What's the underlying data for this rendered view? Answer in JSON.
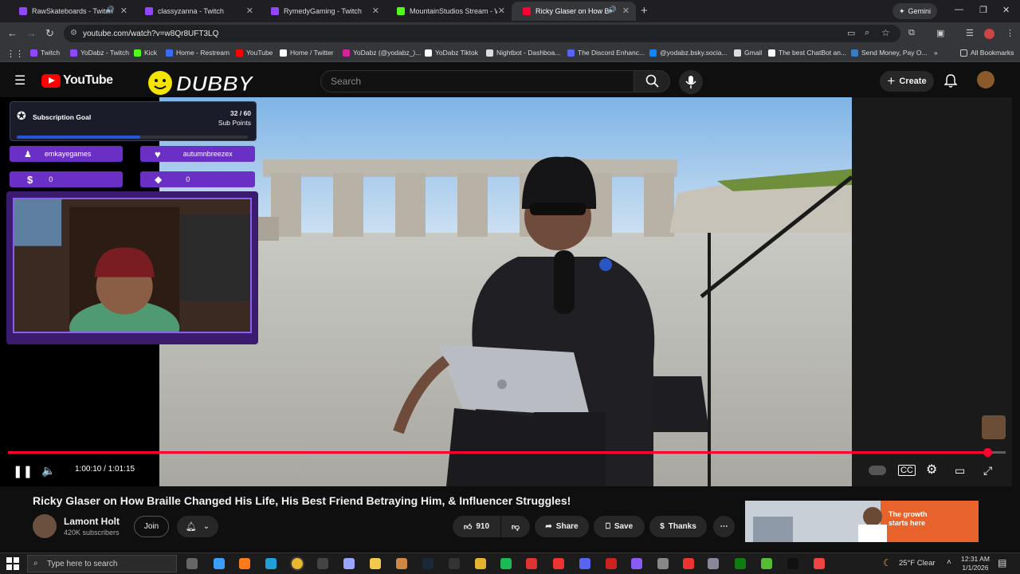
{
  "browser": {
    "tabs": [
      {
        "title": "RawSkateboards - Twitch",
        "color": "#9146ff",
        "active": false,
        "audio": true
      },
      {
        "title": "classyzanna - Twitch",
        "color": "#9146ff",
        "active": false,
        "audio": false
      },
      {
        "title": "RymedyGaming - Twitch",
        "color": "#9146ff",
        "active": false,
        "audio": false
      },
      {
        "title": "MountainStudios Stream - Wa",
        "color": "#53fc18",
        "active": false,
        "audio": false
      },
      {
        "title": "Ricky Glaser on How Braille",
        "color": "#ff0033",
        "active": true,
        "audio": true
      }
    ],
    "gemini_label": "Gemini",
    "url": "youtube.com/watch?v=w8Qr8UFT3LQ",
    "bookmarks": [
      {
        "label": "Twitch",
        "icon": "twitch-icon",
        "color": "#9146ff"
      },
      {
        "label": "YoDabz - Twitch",
        "icon": "twitch-icon",
        "color": "#9146ff"
      },
      {
        "label": "Kick",
        "icon": "kick-icon",
        "color": "#53fc18"
      },
      {
        "label": "Home - Restream",
        "icon": "restream-icon",
        "color": "#3b6cf5"
      },
      {
        "label": "YouTube",
        "icon": "youtube-icon",
        "color": "#ff0000"
      },
      {
        "label": "Home / Twitter",
        "icon": "x-icon",
        "color": "#ffffff"
      },
      {
        "label": "YoDabz (@yodabz_)...",
        "icon": "instagram-icon",
        "color": "#d6249f"
      },
      {
        "label": "YoDabz Tiktok",
        "icon": "tiktok-icon",
        "color": "#ffffff"
      },
      {
        "label": "Nightbot - Dashboa...",
        "icon": "nightbot-icon",
        "color": "#dddddd"
      },
      {
        "label": "The Discord Enhanc...",
        "icon": "discord-icon",
        "color": "#5865f2"
      },
      {
        "label": "@yodabz.bsky.socia...",
        "icon": "bluesky-icon",
        "color": "#1185fe"
      },
      {
        "label": "Gmail",
        "icon": "gmail-icon",
        "color": "#dddddd"
      },
      {
        "label": "The best ChatBot an...",
        "icon": "chatbot-icon",
        "color": "#ffffff"
      },
      {
        "label": "Send Money, Pay O...",
        "icon": "paypal-icon",
        "color": "#3b7bbf"
      }
    ],
    "all_bookmarks": "All Bookmarks"
  },
  "youtube": {
    "logo_text": "YouTube",
    "channel_banner": "DUBBY",
    "search_placeholder": "Search",
    "create_label": "Create"
  },
  "overlay": {
    "goal_title": "Subscription Goal",
    "goal_count": "32 / 60",
    "goal_unit": "Sub Points",
    "goal_progress": 0.533,
    "follower": "emkayegames",
    "subscriber": "autumnbreezex",
    "donations": "0",
    "bits": "0"
  },
  "player": {
    "time": "1:00:10 / 1:01:15",
    "progress": 0.982
  },
  "video": {
    "title": "Ricky Glaser on How Braille Changed His Life, His Best Friend Betraying Him, & Influencer Struggles!",
    "channel": "Lamont Holt",
    "subscribers": "420K subscribers",
    "join_label": "Join",
    "likes": "910",
    "share_label": "Share",
    "save_label": "Save",
    "thanks_label": "Thanks",
    "ad_text_1": "The growth",
    "ad_text_2": "starts here"
  },
  "taskbar": {
    "search_placeholder": "Type here to search",
    "weather": "25°F  Clear",
    "time": "12:31 AM",
    "date": "1/1/2026"
  }
}
